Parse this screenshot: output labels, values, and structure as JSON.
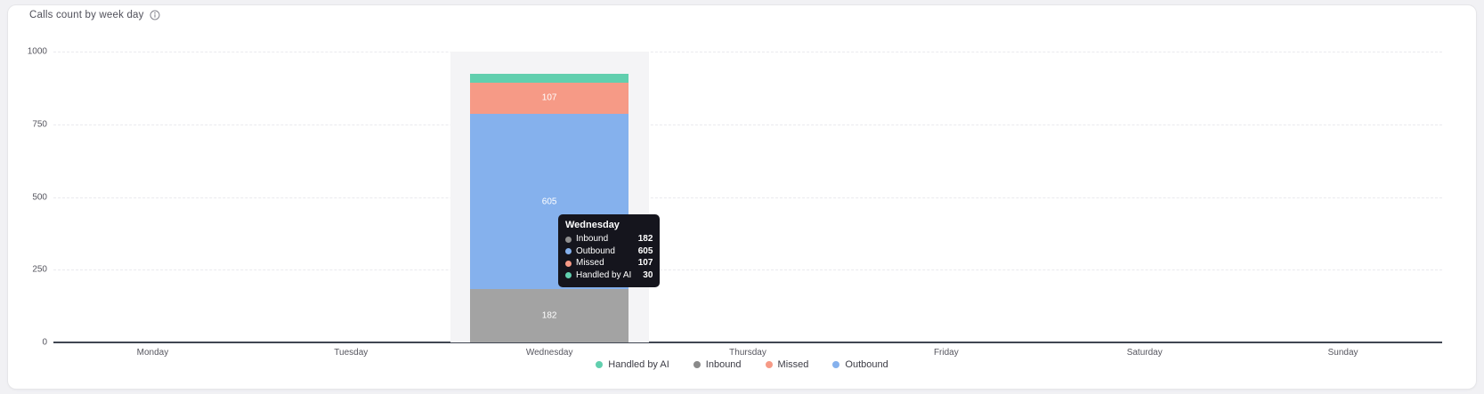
{
  "card": {
    "title": "Calls count by week day"
  },
  "chart_data": {
    "type": "bar",
    "stacked": true,
    "title": "Calls count by week day",
    "categories": [
      "Monday",
      "Tuesday",
      "Wednesday",
      "Thursday",
      "Friday",
      "Saturday",
      "Sunday"
    ],
    "series": [
      {
        "name": "Inbound",
        "color": "#a3a3a3",
        "values": [
          0,
          0,
          182,
          0,
          0,
          0,
          0
        ]
      },
      {
        "name": "Outbound",
        "color": "#85b1ed",
        "values": [
          0,
          0,
          605,
          0,
          0,
          0,
          0
        ]
      },
      {
        "name": "Missed",
        "color": "#f69a86",
        "values": [
          0,
          0,
          107,
          0,
          0,
          0,
          0
        ]
      },
      {
        "name": "Handled by AI",
        "color": "#61cfae",
        "values": [
          0,
          0,
          30,
          0,
          0,
          0,
          0
        ]
      }
    ],
    "ylim": [
      0,
      1000
    ],
    "yticks": [
      0,
      250,
      500,
      750,
      1000
    ],
    "xlabel": "",
    "ylabel": "",
    "grid": true,
    "legend_position": "bottom",
    "highlighted_category": "Wednesday"
  },
  "tooltip": {
    "title": "Wednesday",
    "rows": [
      {
        "label": "Inbound",
        "value": 182,
        "color": "#8f8f8f"
      },
      {
        "label": "Outbound",
        "value": 605,
        "color": "#85b1ed"
      },
      {
        "label": "Missed",
        "value": 107,
        "color": "#f69a86"
      },
      {
        "label": "Handled by AI",
        "value": 30,
        "color": "#61cfae"
      }
    ]
  },
  "legend": {
    "items": [
      {
        "label": "Handled by AI",
        "color": "#61cfae"
      },
      {
        "label": "Inbound",
        "color": "#8a8a8a"
      },
      {
        "label": "Missed",
        "color": "#f69a86"
      },
      {
        "label": "Outbound",
        "color": "#85b1ed"
      }
    ]
  }
}
